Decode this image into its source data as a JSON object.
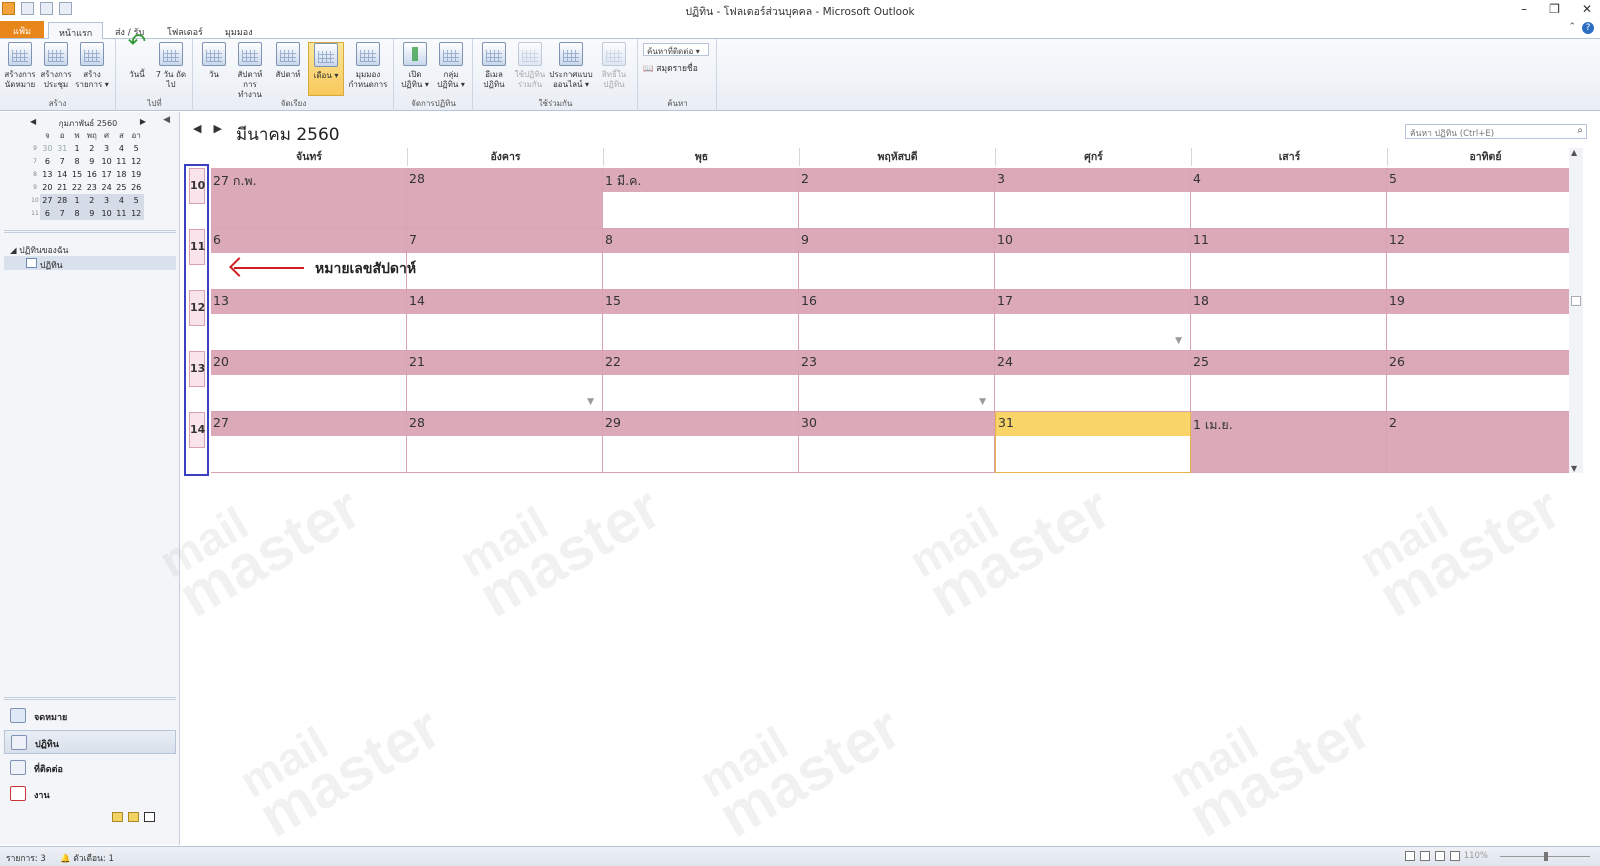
{
  "window": {
    "title": "ปฏิทิน - โฟลเดอร์ส่วนบุคคล - Microsoft Outlook",
    "minimize": "–",
    "restore": "❐",
    "close": "✕"
  },
  "ribbon_tabs": [
    "แฟ้ม",
    "หน้าแรก",
    "ส่ง / รับ",
    "โฟลเดอร์",
    "มุมมอง"
  ],
  "ribbon": {
    "groups": {
      "new": {
        "label": "สร้าง",
        "buttons": [
          "สร้างการ นัดหมาย",
          "สร้างการ ประชุม",
          "สร้าง รายการ ▾"
        ]
      },
      "goto": {
        "label": "ไปที่",
        "buttons": [
          "วันนี้",
          "7 วัน ถัดไป"
        ]
      },
      "arrange": {
        "label": "จัดเรียง",
        "buttons": [
          "วัน",
          "สัปดาห์ การทำงาน",
          "สัปดาห์",
          "เดือน ▾",
          "มุมมอง กำหนดการ"
        ]
      },
      "manage": {
        "label": "จัดการปฏิทิน",
        "buttons": [
          "เปิด ปฏิทิน ▾",
          "กลุ่ม ปฏิทิน ▾"
        ]
      },
      "share": {
        "label": "ใช้ร่วมกัน",
        "buttons": [
          "อีเมล ปฏิทิน",
          "ใช้ปฏิทิน ร่วมกัน",
          "ประกาศแบบ ออนไลน์ ▾",
          "สิทธิ์ใน ปฏิทิน"
        ]
      },
      "find": {
        "label": "ค้นหา",
        "contact_search": "ค้นหาที่ติดต่อ ▾",
        "address_book": "สมุดรายชื่อ"
      }
    }
  },
  "minical": {
    "month_label": "กุมภาพันธ์ 2560",
    "day_names": [
      "จ",
      "อ",
      "พ",
      "พฤ",
      "ศ",
      "ส",
      "อา"
    ],
    "weeks": [
      {
        "wk": "9",
        "days": [
          "30",
          "31",
          "1",
          "2",
          "3",
          "4",
          "5"
        ]
      },
      {
        "wk": "7",
        "days": [
          "6",
          "7",
          "8",
          "9",
          "10",
          "11",
          "12"
        ]
      },
      {
        "wk": "8",
        "days": [
          "13",
          "14",
          "15",
          "16",
          "17",
          "18",
          "19"
        ]
      },
      {
        "wk": "9",
        "days": [
          "20",
          "21",
          "22",
          "23",
          "24",
          "25",
          "26"
        ]
      },
      {
        "wk": "10",
        "days": [
          "27",
          "28",
          "1",
          "2",
          "3",
          "4",
          "5"
        ]
      },
      {
        "wk": "11",
        "days": [
          "6",
          "7",
          "8",
          "9",
          "10",
          "11",
          "12"
        ]
      }
    ]
  },
  "folders": {
    "root": "◢ ปฏิทินของฉัน",
    "item": "ปฏิทิน"
  },
  "nav_buttons": [
    "จดหมาย",
    "ปฏิทิน",
    "ที่ติดต่อ",
    "งาน"
  ],
  "calendar": {
    "title": "มีนาคม 2560",
    "search_placeholder": "ค้นหา ปฏิทิน (Ctrl+E)",
    "day_headers": [
      "จันทร์",
      "อังคาร",
      "พุธ",
      "พฤหัสบดี",
      "ศุกร์",
      "เสาร์",
      "อาทิตย์"
    ],
    "week_numbers": [
      "10",
      "11",
      "12",
      "13",
      "14"
    ],
    "weeks": [
      [
        "27 ก.พ.",
        "28",
        "1 มี.ค.",
        "2",
        "3",
        "4",
        "5"
      ],
      [
        "6",
        "7",
        "8",
        "9",
        "10",
        "11",
        "12"
      ],
      [
        "13",
        "14",
        "15",
        "16",
        "17",
        "18",
        "19"
      ],
      [
        "20",
        "21",
        "22",
        "23",
        "24",
        "25",
        "26"
      ],
      [
        "27",
        "28",
        "29",
        "30",
        "31",
        "1 เม.ย.",
        "2"
      ]
    ],
    "annotation": "หมายเลขสัปดาห์"
  },
  "statusbar": {
    "items": "รายการ: 3",
    "reminders": "ตัวเตือน: 1",
    "zoom": "110%"
  },
  "watermark": {
    "line1": "mail",
    "line2": "master"
  },
  "colors": {
    "month_shade": "#dba9b8",
    "today": "#f9d469",
    "week_number_border": "#3a3fc4",
    "annotation_arrow": "#d01c1f",
    "file_tab": "#e8861a"
  }
}
